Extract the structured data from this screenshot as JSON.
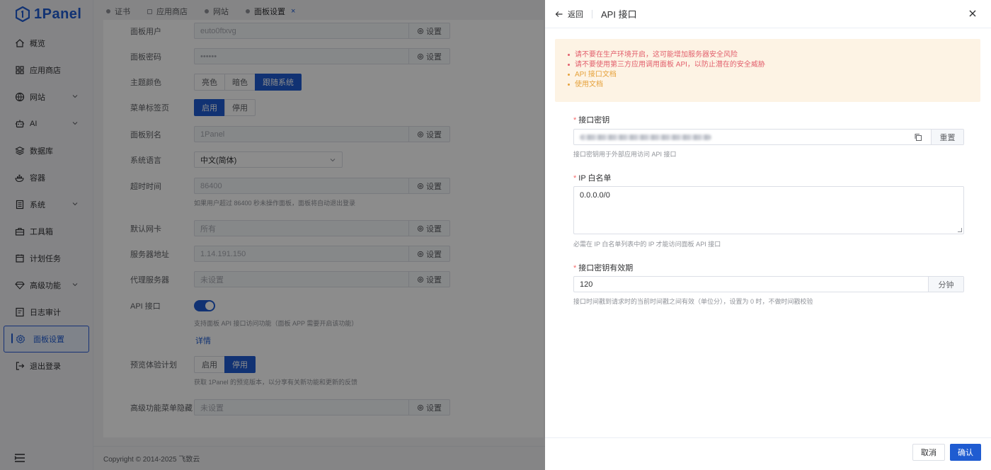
{
  "app": {
    "logo_text": "1Panel",
    "accent_color": "#1f5cd1"
  },
  "sidebar": {
    "items": [
      {
        "label": "概览",
        "icon": "home-icon"
      },
      {
        "label": "应用商店",
        "icon": "apps-icon"
      },
      {
        "label": "网站",
        "icon": "globe-icon",
        "expandable": true
      },
      {
        "label": "AI",
        "icon": "robot-icon",
        "expandable": true
      },
      {
        "label": "数据库",
        "icon": "database-icon"
      },
      {
        "label": "容器",
        "icon": "container-icon"
      },
      {
        "label": "系统",
        "icon": "system-icon",
        "expandable": true
      },
      {
        "label": "工具箱",
        "icon": "toolbox-icon"
      },
      {
        "label": "计划任务",
        "icon": "calendar-icon"
      },
      {
        "label": "高级功能",
        "icon": "diamond-icon",
        "expandable": true
      },
      {
        "label": "日志审计",
        "icon": "log-icon"
      },
      {
        "label": "面板设置",
        "icon": "gear-icon",
        "active": true
      },
      {
        "label": "退出登录",
        "icon": "logout-icon"
      }
    ]
  },
  "tabs": [
    {
      "label": "证书"
    },
    {
      "label": "应用商店"
    },
    {
      "label": "网站"
    },
    {
      "label": "面板设置",
      "active": true,
      "close": "×"
    }
  ],
  "settings": {
    "panel_user": {
      "label": "面板用户",
      "value": "euto0ftxvg",
      "button": "设置"
    },
    "panel_password": {
      "label": "面板密码",
      "value": "••••••",
      "button": "设置"
    },
    "theme": {
      "label": "主题颜色",
      "options": [
        "亮色",
        "暗色",
        "跟随系统"
      ],
      "selected": "跟随系统"
    },
    "menu_tabs": {
      "label": "菜单标签页",
      "options": [
        "启用",
        "停用"
      ],
      "selected": "启用"
    },
    "panel_alias": {
      "label": "面板别名",
      "value": "1Panel",
      "button": "设置"
    },
    "language": {
      "label": "系统语言",
      "value": "中文(简体)"
    },
    "timeout": {
      "label": "超时时间",
      "value": "86400",
      "button": "设置",
      "hint": "如果用户超过 86400 秒未操作面板，面板将自动退出登录"
    },
    "default_nic": {
      "label": "默认网卡",
      "value": "所有",
      "button": "设置"
    },
    "server_address": {
      "label": "服务器地址",
      "value": "1.14.191.150",
      "button": "设置"
    },
    "proxy": {
      "label": "代理服务器",
      "value": "未设置",
      "button": "设置"
    },
    "api": {
      "label": "API 接口",
      "enabled": true,
      "hint": "支持面板 API 接口访问功能（面板 APP 需要开启该功能）",
      "detail_link": "详情"
    },
    "preview": {
      "label": "预览体验计划",
      "options": [
        "启用",
        "停用"
      ],
      "selected": "停用",
      "hint": "获取 1Panel 的预览版本，以分享有关新功能和更新的反馈"
    },
    "hide_menu": {
      "label": "高级功能菜单隐藏",
      "value": "未设置",
      "button": "设置"
    }
  },
  "footer": {
    "copyright": "Copyright © 2014-2025 飞致云"
  },
  "drawer": {
    "back_label": "返回",
    "title": "API 接口",
    "alerts": [
      {
        "text": "请不要在生产环境开启，这可能增加服务器安全风险",
        "type": "danger"
      },
      {
        "text": "请不要使用第三方应用调用面板 API，以防止潜在的安全威胁",
        "type": "danger"
      },
      {
        "text": "API 接口文档",
        "type": "warn"
      },
      {
        "text": "使用文档",
        "type": "warn"
      }
    ],
    "api_key": {
      "label": "接口密钥",
      "reset_label": "重置",
      "hint": "接口密钥用于外部应用访问 API 接口"
    },
    "ip_whitelist": {
      "label": "IP 白名单",
      "value": "0.0.0.0/0",
      "hint": "必需在 IP 白名单列表中的 IP 才能访问面板 API 接口"
    },
    "validity": {
      "label": "接口密钥有效期",
      "value": "120",
      "unit": "分钟",
      "hint": "接口时间戳到请求时的当前时间戳之间有效（单位分），设置为 0 时，不做时间戳校验"
    },
    "cancel_label": "取消",
    "confirm_label": "确认"
  }
}
